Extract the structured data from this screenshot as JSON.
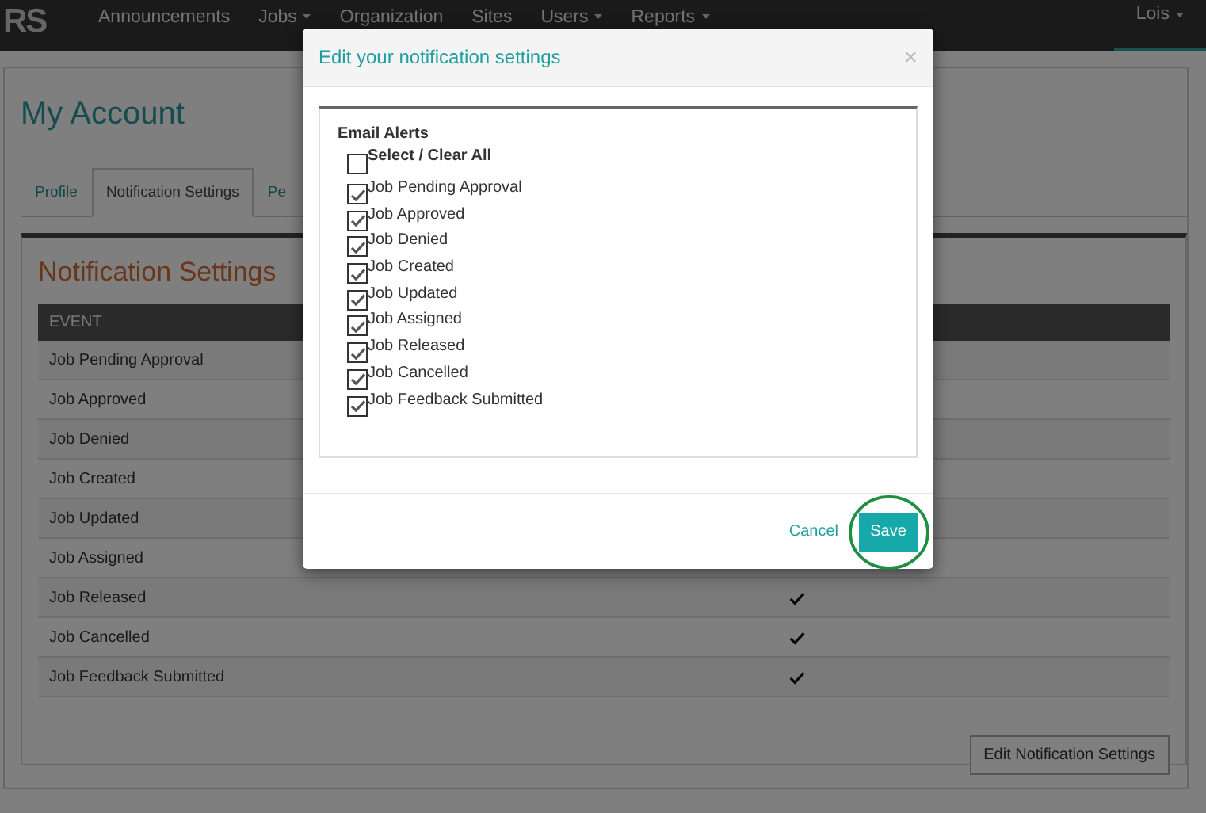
{
  "nav": {
    "logo": "RS",
    "items": [
      {
        "label": "Announcements",
        "dropdown": false
      },
      {
        "label": "Jobs",
        "dropdown": true
      },
      {
        "label": "Organization",
        "dropdown": false
      },
      {
        "label": "Sites",
        "dropdown": false
      },
      {
        "label": "Users",
        "dropdown": true
      },
      {
        "label": "Reports",
        "dropdown": true
      }
    ],
    "user": {
      "label": "Lois",
      "dropdown": true
    }
  },
  "page_title": "My Account",
  "tabs": [
    {
      "label": "Profile",
      "selected": false
    },
    {
      "label": "Notification Settings",
      "selected": true
    },
    {
      "label": "Pe",
      "selected": false
    }
  ],
  "panel": {
    "title": "Notification Settings",
    "columns": [
      "EVENT"
    ],
    "rows": [
      {
        "event": "Job Pending Approval"
      },
      {
        "event": "Job Approved"
      },
      {
        "event": "Job Denied"
      },
      {
        "event": "Job Created"
      },
      {
        "event": "Job Updated"
      },
      {
        "event": "Job Assigned"
      },
      {
        "event": "Job Released",
        "email": true
      },
      {
        "event": "Job Cancelled",
        "email": true
      },
      {
        "event": "Job Feedback Submitted",
        "email": true
      }
    ],
    "button": "Edit Notification Settings"
  },
  "modal": {
    "title": "Edit your notification settings",
    "close": "×",
    "section": "Email Alerts",
    "select_all": {
      "label": "Select / Clear All",
      "checked": false
    },
    "options": [
      {
        "label": "Job Pending Approval",
        "checked": true
      },
      {
        "label": "Job Approved",
        "checked": true
      },
      {
        "label": "Job Denied",
        "checked": true
      },
      {
        "label": "Job Created",
        "checked": true
      },
      {
        "label": "Job Updated",
        "checked": true
      },
      {
        "label": "Job Assigned",
        "checked": true
      },
      {
        "label": "Job Released",
        "checked": true
      },
      {
        "label": "Job Cancelled",
        "checked": true
      },
      {
        "label": "Job Feedback Submitted",
        "checked": true
      }
    ],
    "cancel": "Cancel",
    "save": "Save"
  }
}
